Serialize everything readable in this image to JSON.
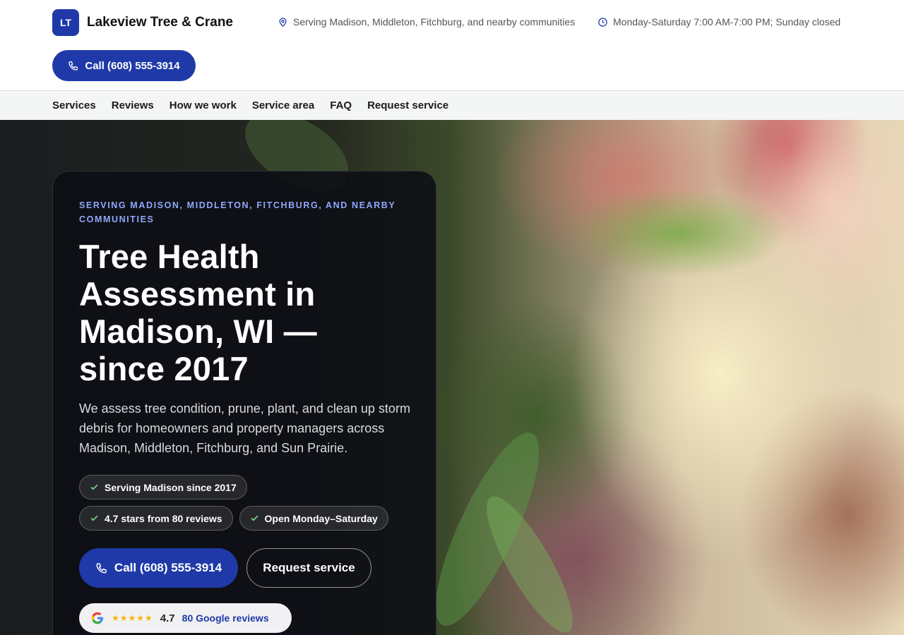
{
  "brand": {
    "logo_text": "LT",
    "name": "Lakeview Tree & Crane"
  },
  "header": {
    "location": "Serving Madison, Middleton, Fitchburg, and nearby communities",
    "hours": "Monday-Saturday 7:00 AM-7:00 PM; Sunday closed",
    "call_label": "Call (608) 555-3914"
  },
  "nav": {
    "items": [
      "Services",
      "Reviews",
      "How we work",
      "Service area",
      "FAQ",
      "Request service"
    ]
  },
  "hero": {
    "eyebrow": "Serving Madison, Middleton, Fitchburg, and nearby communities",
    "headline": "Tree Health Assessment in Madison, WI — since 2017",
    "lead": "We assess tree condition, prune, plant, and clean up storm debris for homeowners and property managers across Madison, Middleton, Fitchburg, and Sun Prairie.",
    "chips": [
      "Serving Madison since 2017",
      "4.7 stars from 80 reviews",
      "Open Monday–Saturday"
    ],
    "cta_primary": "Call (608) 555-3914",
    "cta_secondary": "Request service",
    "rating": {
      "stars": "★★★★★",
      "score": "4.7",
      "link": "80 Google reviews"
    }
  },
  "colors": {
    "accent": "#1f3aa8",
    "eyebrow": "#8fa8ff",
    "star": "#f5b301"
  },
  "icons": {
    "location": "map-pin-icon",
    "hours": "clock-icon",
    "call": "phone-icon",
    "chip": "check-icon",
    "rating": "google-g-icon"
  }
}
